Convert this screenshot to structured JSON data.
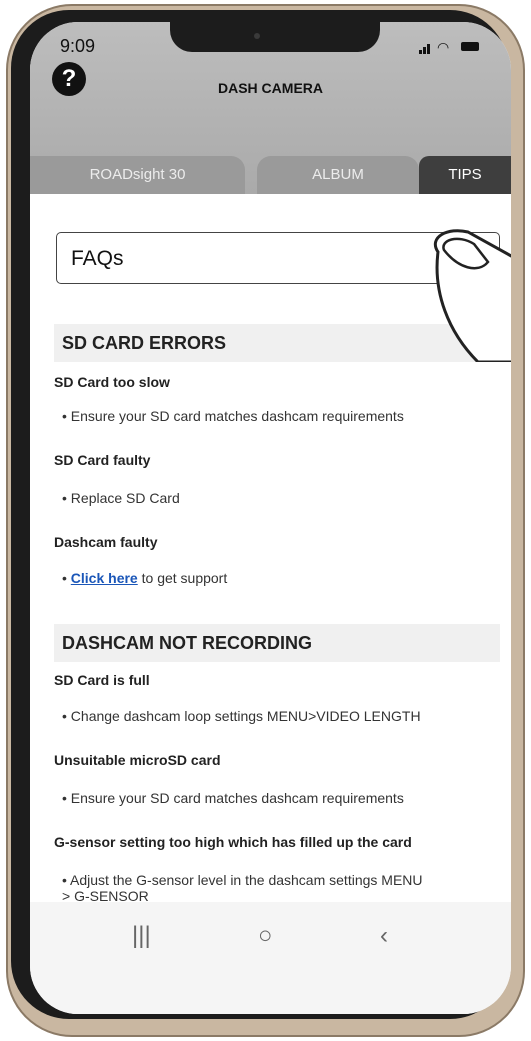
{
  "status_bar": {
    "time": "9:09"
  },
  "header": {
    "title": "DASH CAMERA",
    "help_icon": "question-circle-icon"
  },
  "tabs": [
    {
      "label": "ROADsight 30",
      "active": false
    },
    {
      "label": "ALBUM",
      "active": false
    },
    {
      "label": "TIPS",
      "active": true
    }
  ],
  "faqs": {
    "label": "FAQs"
  },
  "sections": [
    {
      "title": "SD CARD ERRORS",
      "items": [
        {
          "question": "SD Card too slow",
          "answer": "• Ensure your SD card matches dashcam requirements"
        },
        {
          "question": "SD Card faulty",
          "answer": "• Replace SD Card"
        },
        {
          "question": "Dashcam faulty",
          "answer_prefix": "•",
          "answer_link": "Click here",
          "answer_suffix": "to get support"
        }
      ]
    },
    {
      "title": "DASHCAM NOT RECORDING",
      "items": [
        {
          "question": "SD Card is full",
          "answer": "• Change dashcam loop settings MENU>VIDEO LENGTH"
        },
        {
          "question": "Unsuitable microSD card",
          "answer": "• Ensure your SD card matches dashcam requirements"
        },
        {
          "question": "G-sensor setting too high which has filled up the card",
          "answer_line1": "• Adjust the G-sensor level in the dashcam settings MENU",
          "answer_line2": "> G-SENSOR"
        }
      ]
    }
  ],
  "navbar": {
    "recent": "|||",
    "home": "○",
    "back": "‹"
  },
  "colors": {
    "header_bg": "#b3b3b3",
    "active_tab": "#3e3e3e",
    "link": "#1a56b8"
  }
}
